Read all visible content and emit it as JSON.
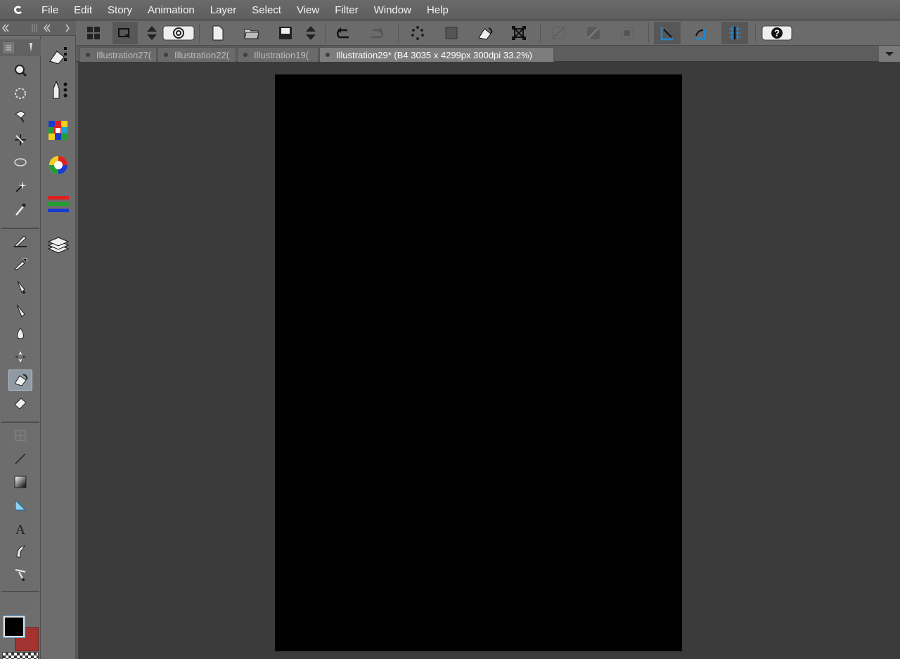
{
  "menubar": {
    "items": [
      "File",
      "Edit",
      "Story",
      "Animation",
      "Layer",
      "Select",
      "View",
      "Filter",
      "Window",
      "Help"
    ]
  },
  "toolbar": {
    "buttons": [
      "dashboard-icon",
      "capture-icon",
      "spin-updown-icon",
      "clip-studio-icon",
      "new-icon",
      "open-icon",
      "save-icon",
      "spin-updown-icon",
      "undo-icon",
      "redo-icon",
      "lasso-dots-icon",
      "select-all-icon",
      "fill-icon",
      "transform-icon",
      "clear-icon",
      "fill-layer-icon",
      "crop-icon",
      "ruler-snap-icon",
      "special-ruler-icon",
      "grid-snap-icon",
      "help-icon"
    ]
  },
  "tool_palette": {
    "tools": [
      "zoom-icon",
      "rotate-icon",
      "operation-icon",
      "move-layer-icon",
      "lasso-icon",
      "magic-wand-icon",
      "eyedropper-icon",
      "pen-icon",
      "pencil-icon",
      "brush-icon",
      "airbrush-icon",
      "blend-icon",
      "decoration-icon",
      "fill-icon",
      "eraser-icon",
      "frame-icon",
      "line-icon",
      "gradient-icon",
      "ruler-icon",
      "text-icon",
      "balloon-icon",
      "correct-line-icon"
    ],
    "selected_tool": "fill-icon"
  },
  "sub_palette": {
    "items": [
      "sub-tool-icon",
      "tool-property-icon",
      "color-set-icon",
      "color-wheel-icon",
      "color-slider-icon",
      "layer-icon"
    ]
  },
  "tabs": [
    {
      "label": "Illustration27(",
      "active": false
    },
    {
      "label": "Illustration22(",
      "active": false
    },
    {
      "label": "Illustration19(",
      "active": false
    },
    {
      "label": "Illustration29* (B4 3035 x 4299px 300dpi 33.2%)",
      "active": true
    }
  ],
  "colors": {
    "main_color": "#000000",
    "sub_color": "#a33330",
    "accent_blue": "#3f8fd8"
  },
  "canvas": {
    "fill": "#000000"
  }
}
